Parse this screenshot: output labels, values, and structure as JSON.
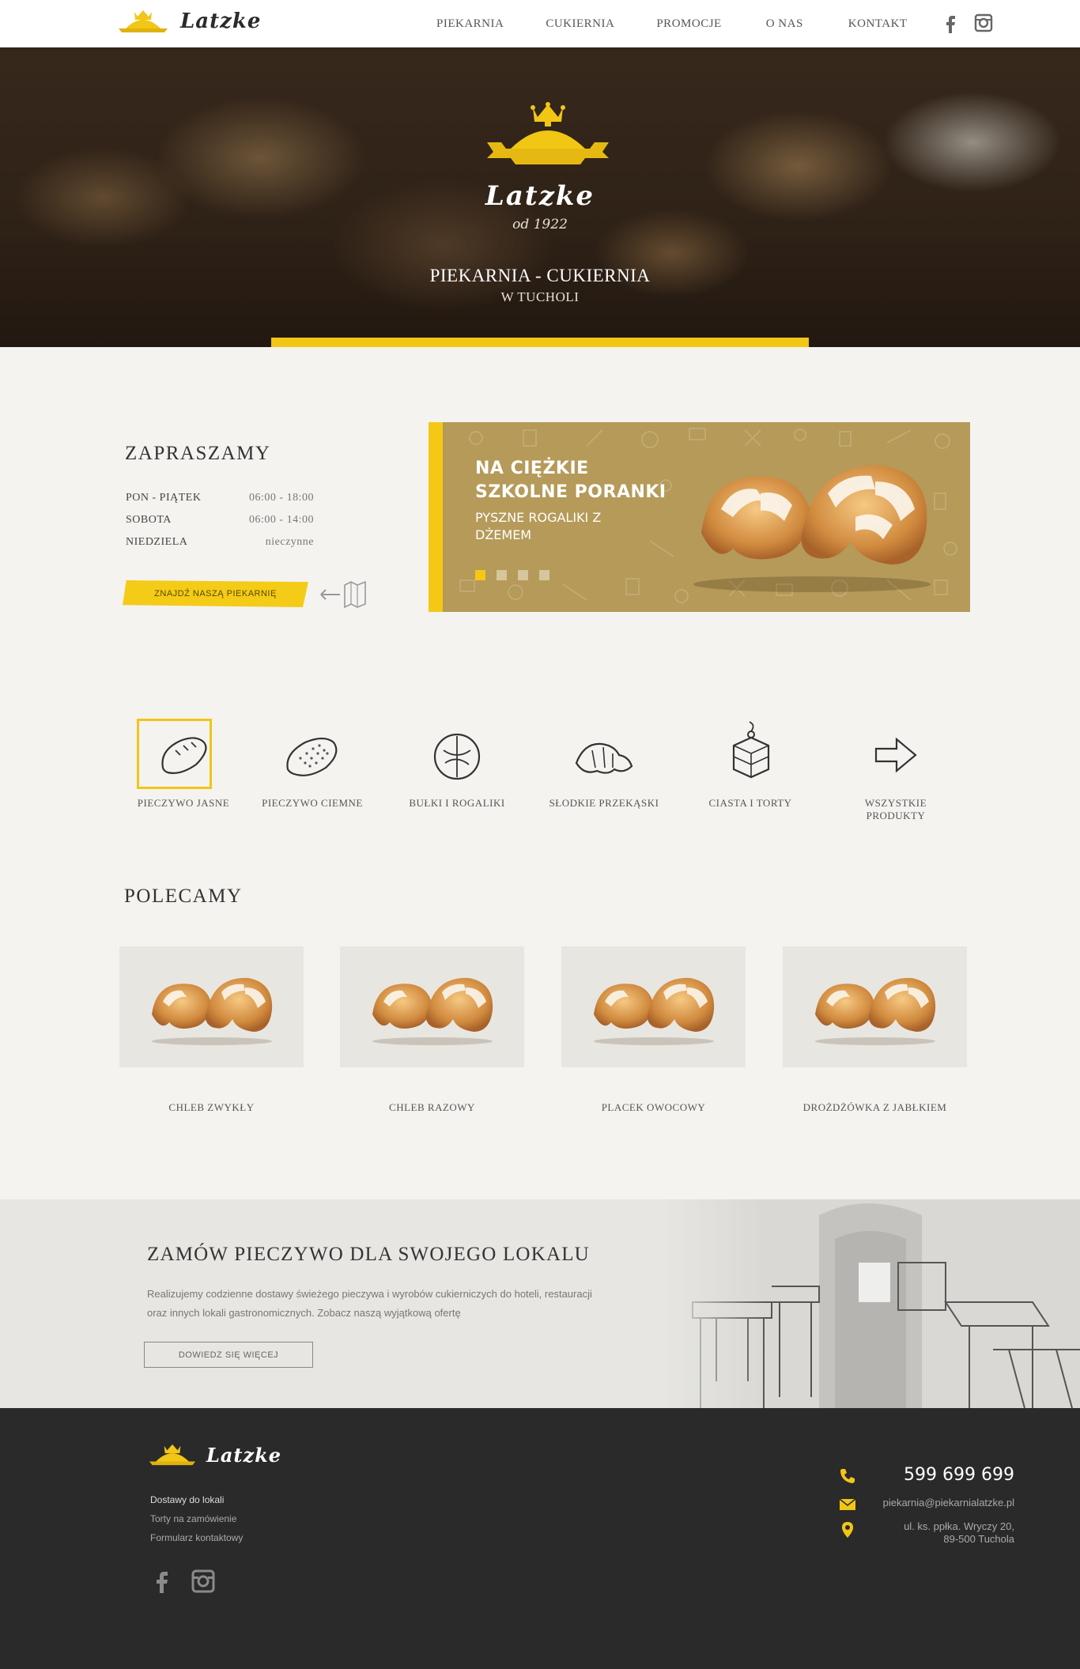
{
  "nav": {
    "brand": "Latzke",
    "menu": [
      "PIEKARNIA",
      "CUKIERNIA",
      "PROMOCJE",
      "O NAS",
      "KONTAKT"
    ],
    "social": [
      {
        "icon": "facebook-icon"
      },
      {
        "icon": "instagram-icon"
      }
    ]
  },
  "hero": {
    "script": "Latzke",
    "since": "od 1922",
    "tagline1": "PIEKARNIA - CUKIERNIA",
    "tagline2": "W TUCHOLI"
  },
  "hours": {
    "title": "ZAPRASZAMY",
    "rows": [
      {
        "day": "PON - PIĄTEK",
        "time": "06:00 - 18:00"
      },
      {
        "day": "SOBOTA",
        "time": "06:00 - 14:00"
      },
      {
        "day": "NIEDZIELA",
        "time": "nieczynne"
      }
    ],
    "find_button": "ZNAJDŹ NASZĄ PIEKARNIĘ"
  },
  "promo": {
    "headline": "NA CIĘŻKIE SZKOLNE PORANKI",
    "subline": "PYSZNE ROGALIKI Z DŻEMEM",
    "slides": 4,
    "active_slide": 1
  },
  "categories": [
    {
      "label": "PIECZYWO JASNE",
      "icon": "light-bread-icon",
      "active": true
    },
    {
      "label": "PIECZYWO CIEMNE",
      "icon": "dark-bread-icon",
      "active": false
    },
    {
      "label": "BUŁKI I ROGALIKI",
      "icon": "bun-icon",
      "active": false
    },
    {
      "label": "SŁODKIE PRZEKĄSKI",
      "icon": "croissant-icon",
      "active": false
    },
    {
      "label": "CIASTA I TORTY",
      "icon": "cake-icon",
      "active": false
    },
    {
      "label": "WSZYSTKIE PRODUKTY",
      "icon": "arrow-right-icon",
      "active": false
    }
  ],
  "recommended": {
    "title": "POLECAMY",
    "items": [
      {
        "name": "CHLEB ZWYKŁY"
      },
      {
        "name": "CHLEB RAZOWY"
      },
      {
        "name": "PLACEK OWOCOWY"
      },
      {
        "name": "DROŻDŻÓWKA Z JABŁKIEM"
      }
    ]
  },
  "wholesale": {
    "title": "ZAMÓW PIECZYWO DLA SWOJEGO LOKALU",
    "text": "Realizujemy codzienne dostawy świeżego pieczywa i wyrobów cukierniczych do hoteli, restauracji oraz innych lokali gastronomicznych. Zobacz naszą wyjątkową ofertę",
    "button": "DOWIEDZ SIĘ WIĘCEJ"
  },
  "footer": {
    "brand": "Latzke",
    "links": [
      "Dostawy do lokali",
      "Torty na zamówienie",
      "Formularz kontaktowy"
    ],
    "phone": "599 699 699",
    "email": "piekarnia@piekarnialatzke.pl",
    "address_line1": "ul. ks. ppłka. Wryczy 20,",
    "address_line2": "89-500 Tuchola"
  },
  "colors": {
    "accent": "#f1c615",
    "promo_bg": "#b59a59",
    "footer_bg": "#2a2a2a"
  }
}
